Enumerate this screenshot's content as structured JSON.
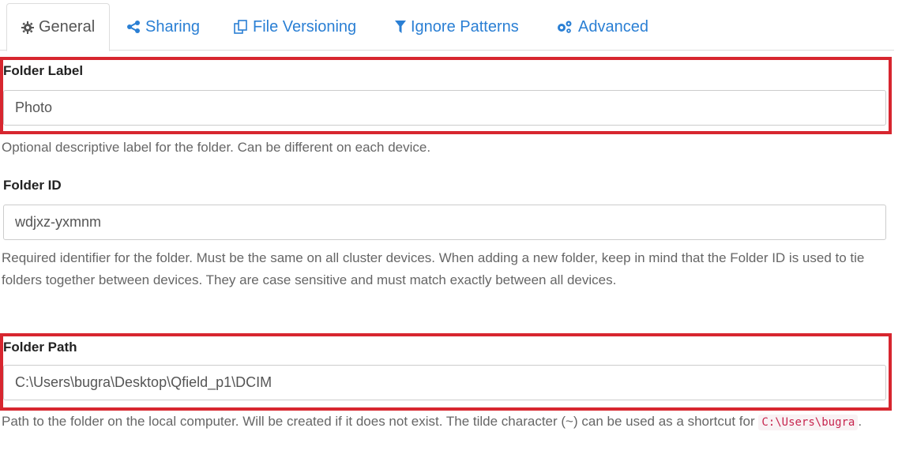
{
  "tabs": [
    {
      "label": "General",
      "icon": "gear-icon",
      "active": true
    },
    {
      "label": "Sharing",
      "icon": "share-icon",
      "active": false
    },
    {
      "label": "File Versioning",
      "icon": "copy-icon",
      "active": false
    },
    {
      "label": "Ignore Patterns",
      "icon": "filter-icon",
      "active": false
    },
    {
      "label": "Advanced",
      "icon": "cogs-icon",
      "active": false
    }
  ],
  "folder_label": {
    "label": "Folder Label",
    "value": "Photo",
    "help": "Optional descriptive label for the folder. Can be different on each device."
  },
  "folder_id": {
    "label": "Folder ID",
    "value": "wdjxz-yxmnm",
    "help": "Required identifier for the folder. Must be the same on all cluster devices. When adding a new folder, keep in mind that the Folder ID is used to tie folders together between devices. They are case sensitive and must match exactly between all devices."
  },
  "folder_path": {
    "label": "Folder Path",
    "value": "C:\\Users\\bugra\\Desktop\\Qfield_p1\\DCIM",
    "help_prefix": "Path to the folder on the local computer. Will be created if it does not exist. The tilde character (~) can be used as a shortcut for",
    "help_code": "C:\\Users\\bugra",
    "help_suffix": "."
  },
  "colors": {
    "link": "#2a7fd4",
    "highlight": "#d7262f",
    "code": "#c7254e"
  }
}
